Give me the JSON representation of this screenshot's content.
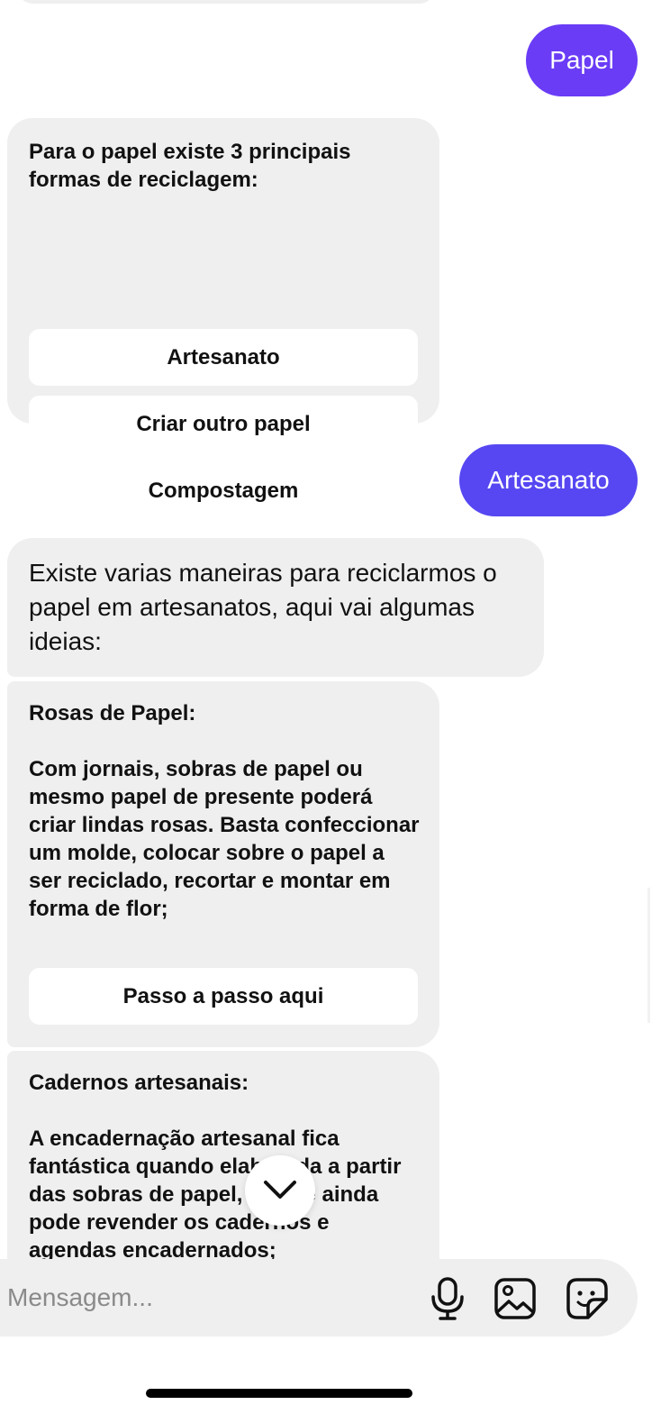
{
  "messages": {
    "user_papel": "Papel",
    "bot_card1": {
      "title": "Para o papel existe 3 principais formas de reciclagem:",
      "options": [
        "Artesanato",
        "Criar outro papel",
        "Compostagem"
      ]
    },
    "user_artesanato": "Artesanato",
    "bot_text": "Existe varias maneiras para reciclarmos o papel em artesanatos, aqui vai algumas ideias:",
    "bot_card2": {
      "title": "Rosas de Papel:",
      "body": "Com jornais, sobras de papel ou mesmo papel de presente poderá criar lindas rosas. Basta confeccionar um molde, colocar sobre o papel a ser reciclado, recortar e montar em forma de flor;",
      "button": "Passo a passo aqui"
    },
    "bot_card3": {
      "title": "Cadernos artesanais:",
      "body": "A encadernação artesanal fica fantástica quando elaborada a partir das sobras de papel, e você ainda pode revender os cadernos e agendas encadernados;"
    }
  },
  "composer": {
    "placeholder": "Mensagem..."
  },
  "icons": {
    "scroll_down": "chevron-down-icon",
    "mic": "microphone-icon",
    "gallery": "image-icon",
    "sticker": "sticker-icon"
  },
  "colors": {
    "user_bubble_1": "#6a3cf6",
    "user_bubble_2": "#5647f2",
    "bot_bubble": "#efefef",
    "option_button": "#ffffff"
  }
}
